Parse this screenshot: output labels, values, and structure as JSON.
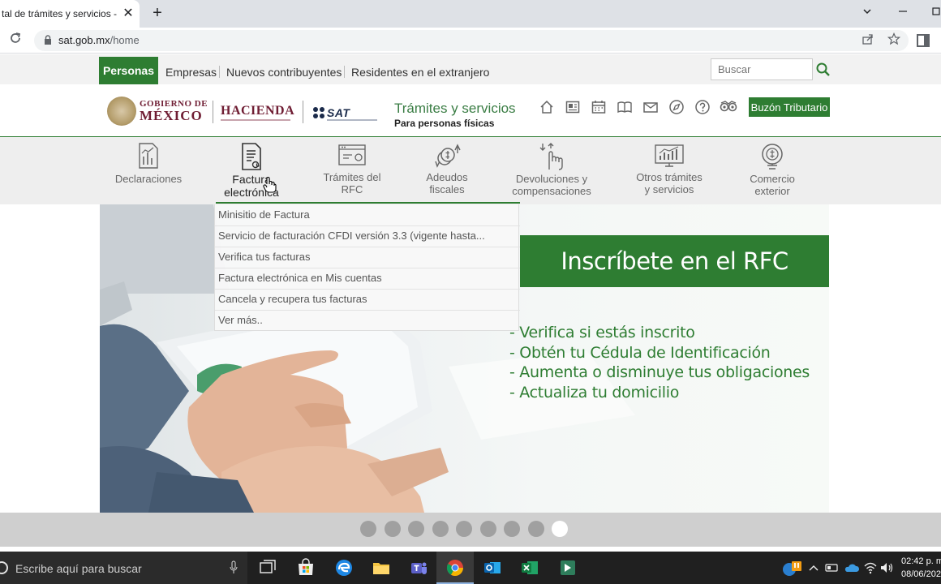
{
  "browser": {
    "tab_title": "tal de trámites y servicios - S/",
    "tab_close": "✕",
    "new_tab": "+",
    "url_domain": "sat.gob.mx",
    "url_path": "/home"
  },
  "site": {
    "topnav": {
      "items": [
        "Personas",
        "Empresas",
        "Nuevos contribuyentes",
        "Residentes en el extranjero"
      ],
      "active": "Personas",
      "search_placeholder": "Buscar"
    },
    "header": {
      "gob_line1": "GOBIERNO DE",
      "gob_line2": "MÉXICO",
      "hacienda": "HACIENDA",
      "sat": "SAT",
      "title": "Trámites y servicios",
      "subtitle": "Para personas físicas",
      "icons": [
        "home-icon",
        "newspaper-icon",
        "calendar-icon",
        "book-icon",
        "mail-icon",
        "compass-icon",
        "help-icon",
        "mask-icon"
      ],
      "buzon": "Buzón Tributario"
    },
    "categories": [
      {
        "label": "Declaraciones",
        "icon": "chart-document-icon"
      },
      {
        "label": "Factura\nelectrónica",
        "icon": "invoice-icon",
        "active": true
      },
      {
        "label": "Trámites del\nRFC",
        "icon": "rfc-window-icon"
      },
      {
        "label": "Adeudos\nfiscales",
        "icon": "debt-coins-icon"
      },
      {
        "label": "Devoluciones y\ncompensaciones",
        "icon": "refund-hand-icon"
      },
      {
        "label": "Otros trámites\ny servicios",
        "icon": "monitor-chart-icon"
      },
      {
        "label": "Comercio\nexterior",
        "icon": "globe-coin-icon"
      }
    ],
    "dropdown": [
      "Minisitio de Factura",
      "Servicio de facturación CFDI versión 3.3 (vigente hasta...",
      "Verifica tus facturas",
      "Factura electrónica en Mis cuentas",
      "Cancela y recupera tus facturas",
      "Ver más.."
    ],
    "hero": {
      "banner": "Inscríbete en el RFC",
      "bullets": [
        "- Verifica si estás inscrito",
        "- Obtén tu Cédula de Identificación",
        "- Aumenta o disminuye tus obligaciones",
        "- Actualiza tu domicilio"
      ]
    },
    "carousel": {
      "total": 9,
      "active_index": 8
    }
  },
  "taskbar": {
    "search_text": "Escribe aquí para buscar",
    "apps": [
      "task-view-icon",
      "store-icon",
      "edge-icon",
      "file-explorer-icon",
      "teams-icon",
      "chrome-icon",
      "outlook-icon",
      "excel-icon",
      "app-green-icon"
    ],
    "time": "02:42 p. m.",
    "date": "08/06/202"
  },
  "colors": {
    "sat_green": "#2e7d32",
    "guinda": "#6f1d33"
  }
}
